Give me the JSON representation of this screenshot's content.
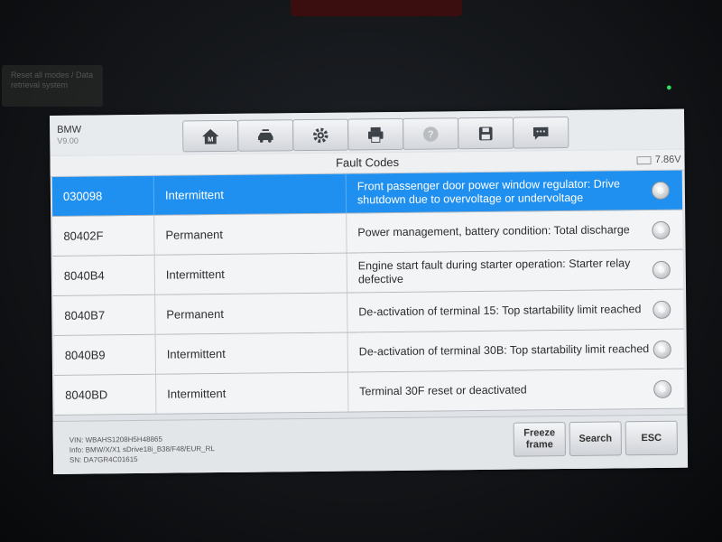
{
  "device": {
    "sticker_text": "Reset all modes / Data retrieval system",
    "status_led_icon": "car-icon"
  },
  "header": {
    "brand": "BMW",
    "version": "V9.00",
    "icons": [
      "home-icon",
      "vehicle-icon",
      "settings-icon",
      "print-icon",
      "help-icon",
      "save-icon",
      "message-icon"
    ]
  },
  "page": {
    "title": "Fault Codes",
    "voltage": "7.86V"
  },
  "faults": [
    {
      "code": "030098",
      "status": "Intermittent",
      "description": "Front passenger door power window regulator: Drive shutdown due to overvoltage or undervoltage",
      "selected": true
    },
    {
      "code": "80402F",
      "status": "Permanent",
      "description": "Power management, battery condition: Total discharge",
      "selected": false
    },
    {
      "code": "8040B4",
      "status": "Intermittent",
      "description": "Engine start fault during starter operation: Starter relay defective",
      "selected": false
    },
    {
      "code": "8040B7",
      "status": "Permanent",
      "description": "De-activation of terminal 15: Top startability limit reached",
      "selected": false
    },
    {
      "code": "8040B9",
      "status": "Intermittent",
      "description": "De-activation of terminal 30B: Top startability limit reached",
      "selected": false
    },
    {
      "code": "8040BD",
      "status": "Intermittent",
      "description": "Terminal 30F reset or deactivated",
      "selected": false
    }
  ],
  "footer": {
    "vin": "VIN: WBAHS1208H5H48865",
    "info": "Info: BMW/X/X1 sDrive18i_B38/F48/EUR_RL",
    "sn": "SN: DA7GR4C01615",
    "freeze_label": "Freeze frame",
    "search_label": "Search",
    "esc_label": "ESC"
  },
  "colors": {
    "selected_row": "#1f8ff0",
    "row": "#f3f4f6",
    "screen_bg": "#dfe2e6"
  }
}
